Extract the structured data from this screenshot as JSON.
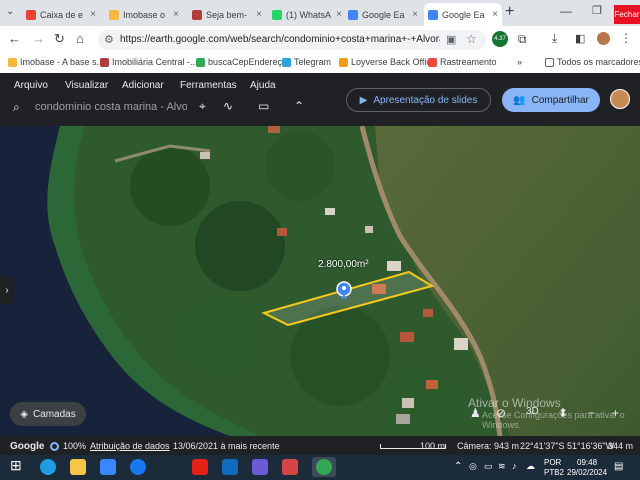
{
  "tabs": [
    {
      "label": "Caixa de e",
      "favicon_color": "#ea4335"
    },
    {
      "label": "Imobase o",
      "favicon_color": "#f6b93b"
    },
    {
      "label": "Seja bem-",
      "favicon_color": "#b23b3b"
    },
    {
      "label": "(1) WhatsA",
      "favicon_color": "#25d366"
    },
    {
      "label": "Google Ea",
      "favicon_color": "#4285f4"
    },
    {
      "label": "Google Ea",
      "favicon_color": "#4285f4",
      "active": true
    }
  ],
  "window": {
    "close_label": "Fechar"
  },
  "toolbar": {
    "url": "https://earth.google.com/web/search/condominio+costa+marina+-+Alvorada+-+d...",
    "extension_badge": "4.37"
  },
  "bookmarks": [
    {
      "label": "Imobase - A base s...",
      "color": "#f6b93b"
    },
    {
      "label": "Imobiliária Central -...",
      "color": "#b23b3b"
    },
    {
      "label": "buscaCepEndereço",
      "color": "#34a853"
    },
    {
      "label": "Telegram",
      "color": "#2aa3df"
    },
    {
      "label": "Loyverse Back Office",
      "color": "#f39c12"
    },
    {
      "label": "Rastreamento",
      "color": "#e84c3d"
    }
  ],
  "bookmarks_more": "»",
  "bookmarks_all": "Todos os marcadores",
  "earth": {
    "menus": [
      "Arquivo",
      "Visualizar",
      "Adicionar",
      "Ferramentas",
      "Ajuda"
    ],
    "search_value": "condominio costa marina - Alvora",
    "slides_label": "Apresentação de slides",
    "share_label": "Compartilhar",
    "measure_label": "2.800,00m²",
    "layers_label": "Camadas",
    "watermark_title": "Ativar o Windows",
    "watermark_sub": "Acesse Configurações para ativar o Windows."
  },
  "status": {
    "brand": "Google",
    "quality": "100%",
    "attribution": "Atribuição de dados",
    "date": "13/06/2021 à mais recente",
    "scale": "100 m",
    "camera": "Câmera: 943 m",
    "coords": "22°41'37\"S 51°16'36\"W",
    "elevation": "344 m"
  },
  "taskbar": {
    "lang_top": "POR",
    "lang_bottom": "PTB2",
    "time": "09:48",
    "date": "29/02/2024"
  }
}
